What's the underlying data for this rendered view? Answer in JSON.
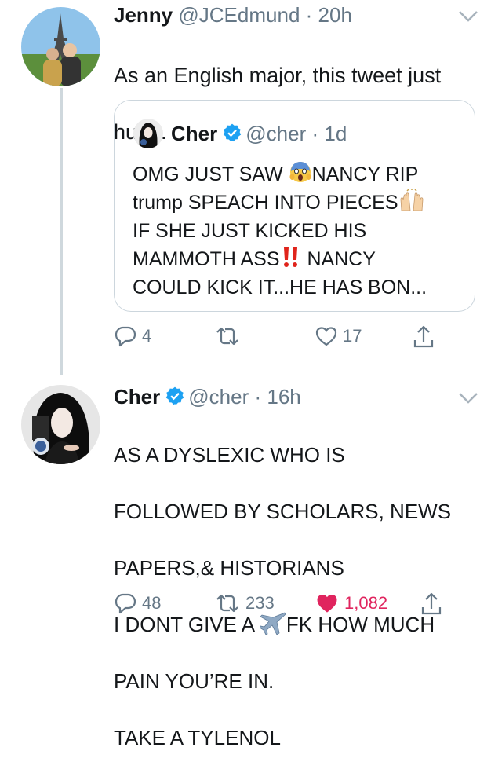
{
  "tweets": [
    {
      "author_name": "Jenny",
      "handle": "@JCEdmund",
      "separator": "·",
      "time": "20h",
      "text_line1": "As an English major, this tweet just",
      "text_line2": "hurts.",
      "quoted": {
        "author_name": "Cher",
        "handle": "@cher",
        "separator": "·",
        "time": "1d",
        "line1_a": "OMG JUST SAW ",
        "line1_b": "NANCY RIP",
        "line2": "trump SPEACH INTO PIECES",
        "line3": "IF SHE  JUST KICKED HIS",
        "line4_a": "MAMMOTH ASS",
        "line4_b": " NANCY",
        "line5": "COULD KICK IT...HE HAS BON..."
      },
      "actions": {
        "replies": "4",
        "retweets": "",
        "likes": "17"
      }
    },
    {
      "author_name": "Cher",
      "handle": "@cher",
      "separator": "·",
      "time": "16h",
      "line1": "AS A DYSLEXIC WHO IS",
      "line2": "FOLLOWED BY SCHOLARS, NEWS",
      "line3": "PAPERS,& HISTORIANS",
      "line4_a": "I DONT GIVE A ",
      "line4_b": "FK HOW MUCH",
      "line5": "PAIN YOU’RE IN.",
      "line6": "TAKE A TYLENOL",
      "actions": {
        "replies": "48",
        "retweets": "233",
        "likes": "1,082"
      }
    }
  ],
  "icons": {
    "reply": "reply-icon",
    "retweet": "retweet-icon",
    "like": "heart-icon",
    "share": "share-icon",
    "verified": "verified-badge-icon",
    "more": "chevron-down-icon"
  },
  "colors": {
    "text": "#14171a",
    "secondary": "#657786",
    "verified": "#1da1f2",
    "like_active": "#e0245e",
    "border": "#ccd6dd"
  }
}
